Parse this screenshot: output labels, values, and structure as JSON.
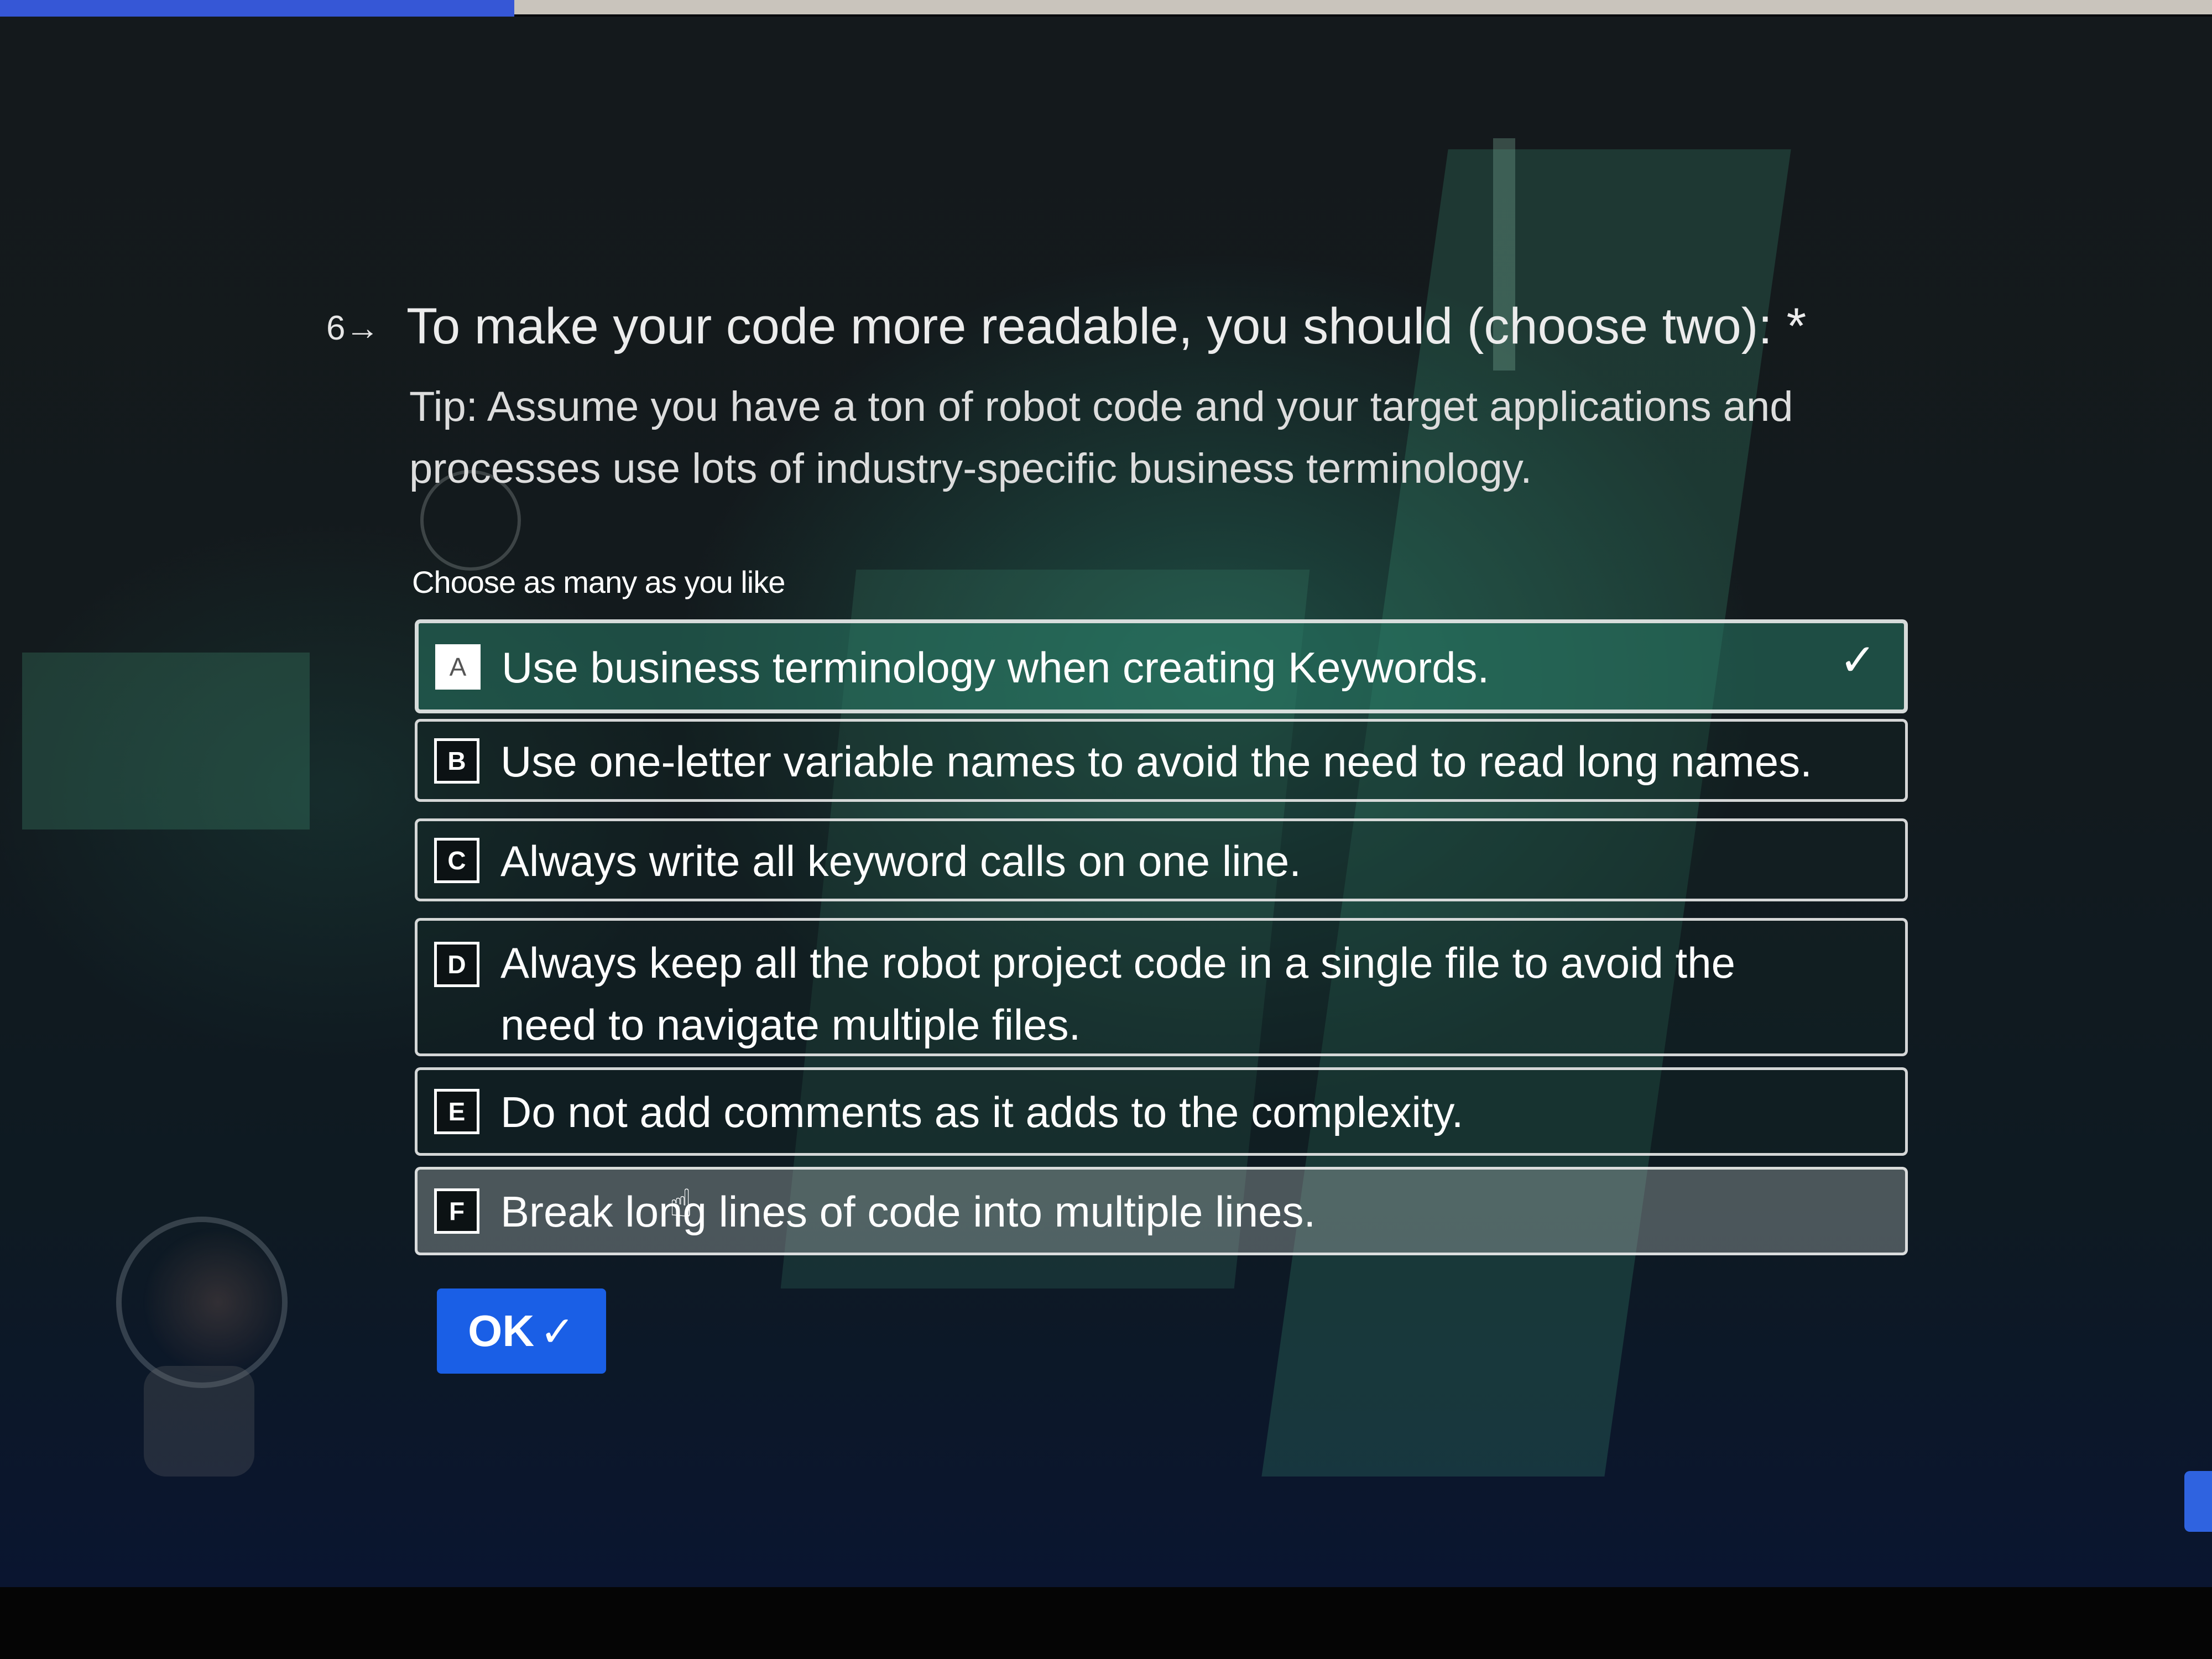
{
  "question": {
    "number": "6→",
    "title": "To make your code more readable, you should (choose two): *",
    "tip": "Tip: Assume you have a ton of robot code and your target applications and processes use lots of industry-specific business terminology.",
    "hint": "Choose as many as you like"
  },
  "options": [
    {
      "key": "A",
      "label": "Use business terminology when creating Keywords.",
      "selected": true
    },
    {
      "key": "B",
      "label": "Use one-letter variable names to avoid the need to read long names.",
      "selected": false
    },
    {
      "key": "C",
      "label": "Always write all keyword calls on one line.",
      "selected": false
    },
    {
      "key": "D",
      "label": "Always keep all the robot project code in a single file to avoid the need to navigate multiple files.",
      "selected": false
    },
    {
      "key": "E",
      "label": "Do not add comments as it adds to the complexity.",
      "selected": false
    },
    {
      "key": "F",
      "label": "Break long lines of code into multiple lines.",
      "selected": false
    }
  ],
  "ok_button": {
    "label": "OK",
    "icon": "check-icon"
  },
  "selected_check_icon": "check-icon",
  "colors": {
    "accent": "#1a5fe6",
    "progress": "#3657d6",
    "selected_option": "#2e7a65"
  }
}
